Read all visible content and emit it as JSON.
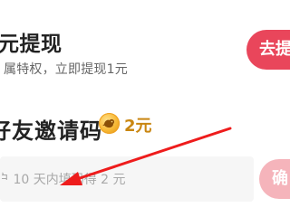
{
  "withdraw": {
    "title": "元提现",
    "description": "属特权，立即提现1元",
    "button_label": "去提"
  },
  "invite": {
    "title": "好友邀请码",
    "reward_icon": "coin-icon",
    "reward_amount": "2元",
    "input_placeholder": "户 10 天内填码得 2 元",
    "confirm_label": "确"
  },
  "colors": {
    "primary_button": "#e9465b",
    "disabled_button": "#f5b4bb",
    "reward_gold": "#c98611",
    "annotation_arrow": "#ee1c1c"
  },
  "annotation": {
    "arrow_icon": "red-arrow-annotation"
  }
}
